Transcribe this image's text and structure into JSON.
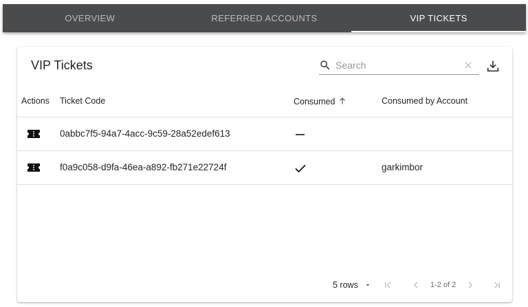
{
  "tabs": [
    {
      "label": "Overview",
      "active": false
    },
    {
      "label": "Referred Accounts",
      "active": false
    },
    {
      "label": "VIP Tickets",
      "active": true
    }
  ],
  "card": {
    "title": "VIP Tickets",
    "search_placeholder": "Search",
    "search_value": ""
  },
  "table": {
    "columns": [
      "Actions",
      "Ticket Code",
      "Consumed",
      "Consumed by Account"
    ],
    "sorted_column": "Consumed",
    "sort_direction": "ascending",
    "rows": [
      {
        "action_icon": "ticket-icon",
        "ticket_code": "0abbc7f5-94a7-4acc-9c59-28a52edef613",
        "consumed": false,
        "consumed_icon": "dash-icon",
        "consumed_by": ""
      },
      {
        "action_icon": "ticket-icon",
        "ticket_code": "f0a9c058-d9fa-46ea-a892-fb271e22724f",
        "consumed": true,
        "consumed_icon": "check-icon",
        "consumed_by": "garkimbor"
      }
    ]
  },
  "pagination": {
    "rows_per_page": "5 rows",
    "range": "1-2 of 2"
  },
  "colors": {
    "tabbar_bg": "#4a4b4d",
    "text_primary": "#212121"
  }
}
